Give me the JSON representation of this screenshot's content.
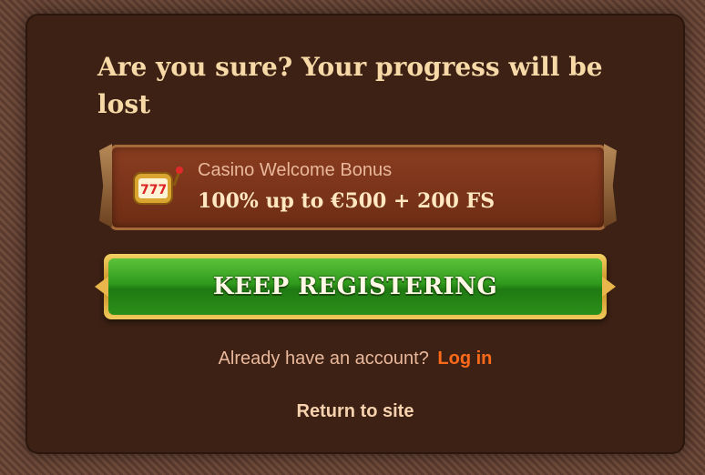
{
  "modal": {
    "title": "Are you sure? Your progress will be lost"
  },
  "bonus": {
    "label": "Casino Welcome Bonus",
    "amount": "100% up to €500 + 200 FS",
    "icon": "slot-machine-icon"
  },
  "cta": {
    "label": "KEEP REGISTERING"
  },
  "account": {
    "prompt": "Already have an account?",
    "login_label": "Log in"
  },
  "return_label": "Return to site",
  "colors": {
    "accent_orange": "#ff6a1a",
    "button_green": "#2f9a1c",
    "button_gold": "#e8b64a",
    "modal_bg": "#3c2114"
  }
}
